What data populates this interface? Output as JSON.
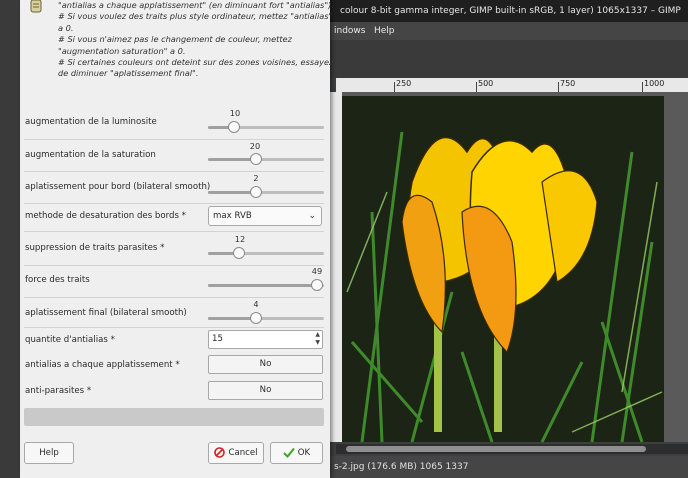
{
  "gimp": {
    "title": "colour 8-bit gamma integer, GIMP built-in sRGB, 1 layer) 1065x1337 – GIMP",
    "menu": [
      "indows",
      "Help"
    ],
    "ruler_labels": [
      "250",
      "500",
      "750",
      "1000"
    ],
    "status": "s-2.jpg (176.6 MB) 1065 1337"
  },
  "dialog": {
    "help_lines": [
      "\"antialias a chaque applatissement\" (en diminuant fort \"antialias\").",
      "# Si vous voulez des traits plus style ordinateur, mettez \"antialias\"",
      "a 0.",
      "# Si vous n'aimez pas le changement de couleur, mettez",
      "\"augmentation saturation\" a 0.",
      "# Si certaines couleurs ont deteint sur des zones voisines, essayez",
      "de diminuer \"aplatissement final\"."
    ],
    "params": {
      "luminosite": {
        "label": "augmentation de la luminosite",
        "value": "10",
        "level": 0.22
      },
      "saturation": {
        "label": "augmentation de la saturation",
        "value": "20",
        "level": 0.41
      },
      "aplat_bord": {
        "label": "aplatissement pour bord (bilateral smooth)",
        "value": "2",
        "level": 0.41
      },
      "desat_method": {
        "label": "methode de desaturation des bords *",
        "value": "max RVB"
      },
      "suppression": {
        "label": "suppression de traits parasites *",
        "value": "12",
        "level": 0.27
      },
      "force": {
        "label": "force des traits",
        "value": "49",
        "level": 0.94
      },
      "aplat_final": {
        "label": "aplatissement final (bilateral smooth)",
        "value": "4",
        "level": 0.41
      },
      "antialias_qty": {
        "label": "quantite d'antialias *",
        "value": "15"
      },
      "antialias_each": {
        "label": "antialias a chaque applatissement *",
        "value": "No"
      },
      "antiparasites": {
        "label": "anti-parasites *",
        "value": "No"
      }
    },
    "buttons": {
      "help": "Help",
      "cancel": "Cancel",
      "ok": "OK"
    }
  }
}
